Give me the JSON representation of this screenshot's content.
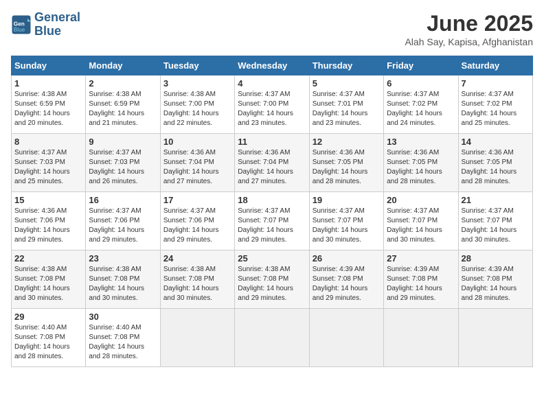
{
  "header": {
    "logo_line1": "General",
    "logo_line2": "Blue",
    "title": "June 2025",
    "subtitle": "Alah Say, Kapisa, Afghanistan"
  },
  "calendar": {
    "days_of_week": [
      "Sunday",
      "Monday",
      "Tuesday",
      "Wednesday",
      "Thursday",
      "Friday",
      "Saturday"
    ],
    "weeks": [
      [
        null,
        null,
        null,
        null,
        null,
        null,
        null
      ]
    ]
  },
  "cells": {
    "week1": [
      {
        "day": null,
        "empty": true
      },
      {
        "day": null,
        "empty": true
      },
      {
        "day": null,
        "empty": true
      },
      {
        "day": null,
        "empty": true
      },
      {
        "day": null,
        "empty": true
      },
      {
        "day": null,
        "empty": true
      },
      {
        "day": null,
        "empty": true
      }
    ]
  },
  "days": [
    {
      "num": "1",
      "sunrise": "4:38 AM",
      "sunset": "6:59 PM",
      "daylight": "14 hours and 20 minutes."
    },
    {
      "num": "2",
      "sunrise": "4:38 AM",
      "sunset": "6:59 PM",
      "daylight": "14 hours and 21 minutes."
    },
    {
      "num": "3",
      "sunrise": "4:38 AM",
      "sunset": "7:00 PM",
      "daylight": "14 hours and 22 minutes."
    },
    {
      "num": "4",
      "sunrise": "4:37 AM",
      "sunset": "7:00 PM",
      "daylight": "14 hours and 23 minutes."
    },
    {
      "num": "5",
      "sunrise": "4:37 AM",
      "sunset": "7:01 PM",
      "daylight": "14 hours and 23 minutes."
    },
    {
      "num": "6",
      "sunrise": "4:37 AM",
      "sunset": "7:02 PM",
      "daylight": "14 hours and 24 minutes."
    },
    {
      "num": "7",
      "sunrise": "4:37 AM",
      "sunset": "7:02 PM",
      "daylight": "14 hours and 25 minutes."
    },
    {
      "num": "8",
      "sunrise": "4:37 AM",
      "sunset": "7:03 PM",
      "daylight": "14 hours and 25 minutes."
    },
    {
      "num": "9",
      "sunrise": "4:37 AM",
      "sunset": "7:03 PM",
      "daylight": "14 hours and 26 minutes."
    },
    {
      "num": "10",
      "sunrise": "4:36 AM",
      "sunset": "7:04 PM",
      "daylight": "14 hours and 27 minutes."
    },
    {
      "num": "11",
      "sunrise": "4:36 AM",
      "sunset": "7:04 PM",
      "daylight": "14 hours and 27 minutes."
    },
    {
      "num": "12",
      "sunrise": "4:36 AM",
      "sunset": "7:05 PM",
      "daylight": "14 hours and 28 minutes."
    },
    {
      "num": "13",
      "sunrise": "4:36 AM",
      "sunset": "7:05 PM",
      "daylight": "14 hours and 28 minutes."
    },
    {
      "num": "14",
      "sunrise": "4:36 AM",
      "sunset": "7:05 PM",
      "daylight": "14 hours and 28 minutes."
    },
    {
      "num": "15",
      "sunrise": "4:36 AM",
      "sunset": "7:06 PM",
      "daylight": "14 hours and 29 minutes."
    },
    {
      "num": "16",
      "sunrise": "4:37 AM",
      "sunset": "7:06 PM",
      "daylight": "14 hours and 29 minutes."
    },
    {
      "num": "17",
      "sunrise": "4:37 AM",
      "sunset": "7:06 PM",
      "daylight": "14 hours and 29 minutes."
    },
    {
      "num": "18",
      "sunrise": "4:37 AM",
      "sunset": "7:07 PM",
      "daylight": "14 hours and 29 minutes."
    },
    {
      "num": "19",
      "sunrise": "4:37 AM",
      "sunset": "7:07 PM",
      "daylight": "14 hours and 30 minutes."
    },
    {
      "num": "20",
      "sunrise": "4:37 AM",
      "sunset": "7:07 PM",
      "daylight": "14 hours and 30 minutes."
    },
    {
      "num": "21",
      "sunrise": "4:37 AM",
      "sunset": "7:07 PM",
      "daylight": "14 hours and 30 minutes."
    },
    {
      "num": "22",
      "sunrise": "4:38 AM",
      "sunset": "7:08 PM",
      "daylight": "14 hours and 30 minutes."
    },
    {
      "num": "23",
      "sunrise": "4:38 AM",
      "sunset": "7:08 PM",
      "daylight": "14 hours and 30 minutes."
    },
    {
      "num": "24",
      "sunrise": "4:38 AM",
      "sunset": "7:08 PM",
      "daylight": "14 hours and 30 minutes."
    },
    {
      "num": "25",
      "sunrise": "4:38 AM",
      "sunset": "7:08 PM",
      "daylight": "14 hours and 29 minutes."
    },
    {
      "num": "26",
      "sunrise": "4:39 AM",
      "sunset": "7:08 PM",
      "daylight": "14 hours and 29 minutes."
    },
    {
      "num": "27",
      "sunrise": "4:39 AM",
      "sunset": "7:08 PM",
      "daylight": "14 hours and 29 minutes."
    },
    {
      "num": "28",
      "sunrise": "4:39 AM",
      "sunset": "7:08 PM",
      "daylight": "14 hours and 28 minutes."
    },
    {
      "num": "29",
      "sunrise": "4:40 AM",
      "sunset": "7:08 PM",
      "daylight": "14 hours and 28 minutes."
    },
    {
      "num": "30",
      "sunrise": "4:40 AM",
      "sunset": "7:08 PM",
      "daylight": "14 hours and 28 minutes."
    }
  ]
}
